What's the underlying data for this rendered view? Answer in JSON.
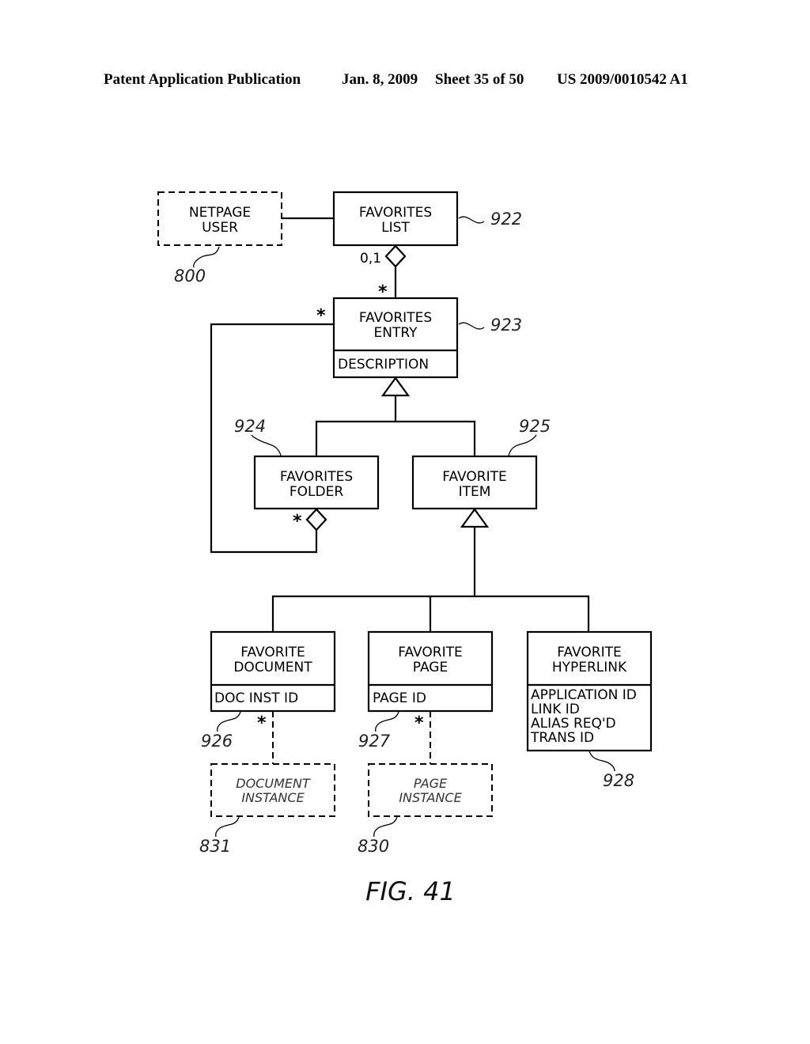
{
  "header": {
    "left": "Patent Application Publication",
    "date": "Jan. 8, 2009",
    "sheet": "Sheet 35 of 50",
    "number": "US 2009/0010542 A1"
  },
  "classes": {
    "netpage_user": {
      "line1": "NETPAGE",
      "line2": "USER",
      "ref": "800"
    },
    "favorites_list": {
      "line1": "FAVORITES",
      "line2": "LIST",
      "ref": "922"
    },
    "favorites_entry": {
      "line1": "FAVORITES",
      "line2": "ENTRY",
      "attr1": "DESCRIPTION",
      "ref": "923"
    },
    "favorites_folder": {
      "line1": "FAVORITES",
      "line2": "FOLDER",
      "ref": "924"
    },
    "favorite_item": {
      "line1": "FAVORITE",
      "line2": "ITEM",
      "ref": "925"
    },
    "favorite_document": {
      "line1": "FAVORITE",
      "line2": "DOCUMENT",
      "attr1": "DOC INST ID",
      "ref": "926"
    },
    "favorite_page": {
      "line1": "FAVORITE",
      "line2": "PAGE",
      "attr1": "PAGE ID",
      "ref": "927"
    },
    "favorite_hyperlink": {
      "line1": "FAVORITE",
      "line2": "HYPERLINK",
      "attr1": "APPLICATION ID",
      "attr2": "LINK ID",
      "attr3": "ALIAS REQ'D",
      "attr4": "TRANS ID",
      "ref": "928"
    },
    "document_instance": {
      "line1": "DOCUMENT",
      "line2": "INSTANCE",
      "ref": "831"
    },
    "page_instance": {
      "line1": "PAGE",
      "line2": "INSTANCE",
      "ref": "830"
    }
  },
  "multiplicities": {
    "list_side": "0,1",
    "entry_side": "*",
    "entry_folder_side": "*",
    "folder_side": "*",
    "doc_instance_side": "*",
    "page_instance_side": "*"
  },
  "figure_label": "FIG. 41"
}
